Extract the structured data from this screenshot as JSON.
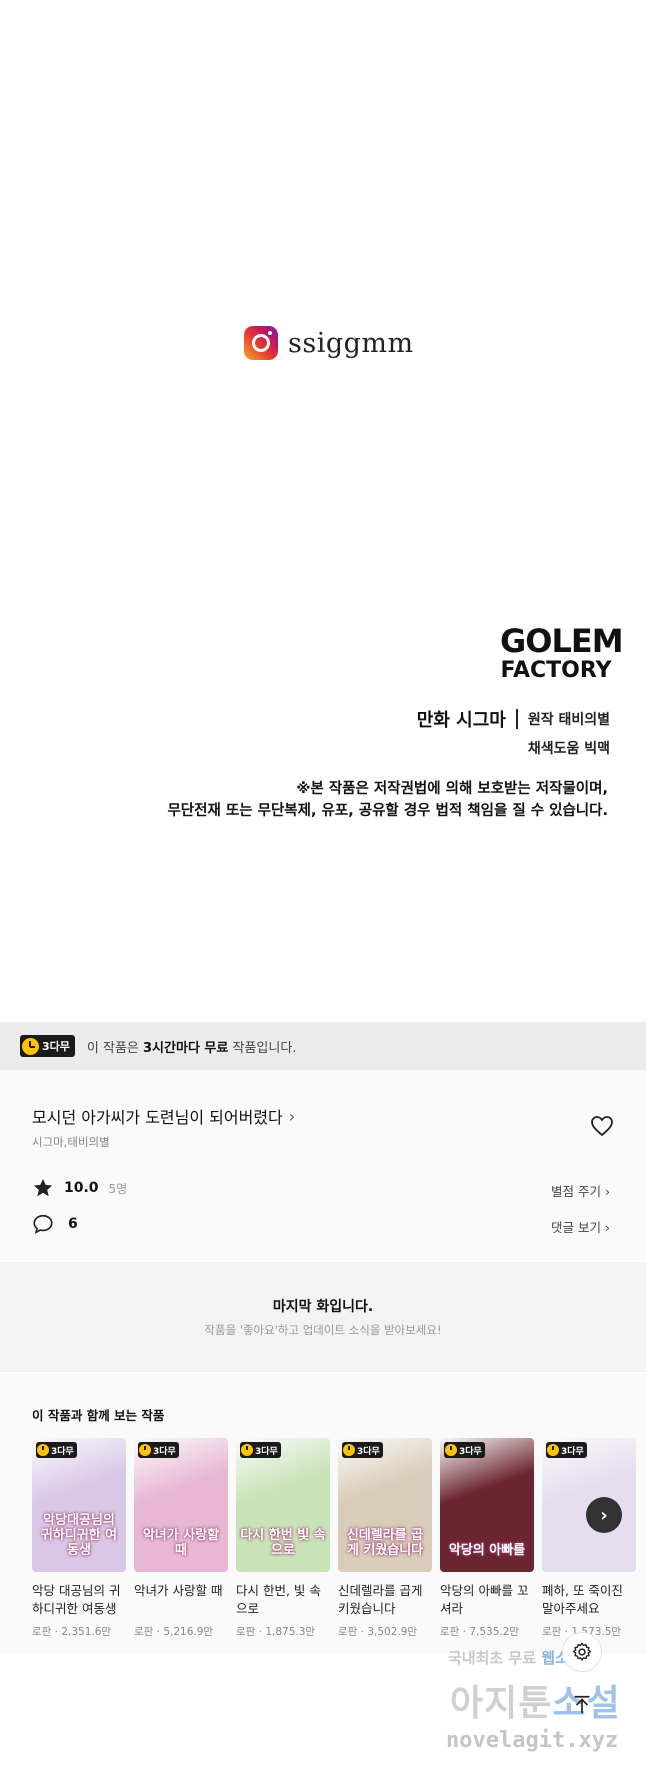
{
  "credits": {
    "instagram_handle": "ssiggmm",
    "studio_line1": "GOLEM",
    "studio_line2": "FACTORY",
    "comic": "만화 시그마",
    "original": "원작 태비의별",
    "coloring": "채색도움 빅맥",
    "copyright_line1": "※본 작품은 저작권법에 의해 보호받는 저작물이며,",
    "copyright_line2": "무단전재 또는 무단복제, 유포, 공유할 경우 법적 책임을 질 수 있습니다."
  },
  "free_banner": {
    "badge": "3다무",
    "text_prefix": "이 작품은 ",
    "text_bold": "3시간마다 무료",
    "text_suffix": " 작품입니다."
  },
  "work": {
    "title": "모시던 아가씨가 도련님이 되어버렸다",
    "authors": "시그마,태비의별",
    "rating": "10.0",
    "rating_count": "5명",
    "rate_link": "별점 주기",
    "comment_count": "6",
    "comment_link": "댓글 보기"
  },
  "last_episode": {
    "title": "마지막 화입니다.",
    "subtitle": "작품을 '좋아요'하고 업데이트 소식을 받아보세요!"
  },
  "recommendations": {
    "title": "이 작품과 함께 보는 작품",
    "badge": "3다무",
    "items": [
      {
        "name": "악당 대공님의 귀하디귀한 여동생",
        "meta": "로판 · 2,351.6만",
        "cover": "악당대공님의 귀하디귀한 여동생",
        "bg": "#d9c7e8"
      },
      {
        "name": "악녀가 사랑할 때",
        "meta": "로판 · 5,216.9만",
        "cover": "악녀가 사랑할 때",
        "bg": "#e8b7d4"
      },
      {
        "name": "다시 한번, 빛 속으로",
        "meta": "로판 · 1,875.3만",
        "cover": "다시 한번 빛 속으로",
        "bg": "#c9e3b8"
      },
      {
        "name": "신데렐라를 곱게 키웠습니다",
        "meta": "로판 · 3,502.9만",
        "cover": "신데렐라를 곱게 키웠습니다",
        "bg": "#d9ccb8"
      },
      {
        "name": "악당의 아빠를 꼬셔라",
        "meta": "로판 · 7,535.2만",
        "cover": "악당의 아빠를",
        "bg": "#6b2530"
      },
      {
        "name": "폐하, 또 죽이진 말아주세요",
        "meta": "로판 · 1,573.5만",
        "cover": "",
        "bg": "#e6ddee"
      }
    ]
  },
  "watermark": {
    "line1a": "국내최초 무료 ",
    "line1b": "웹소설",
    "line2a": "아지툰",
    "line2b": "소설",
    "line3": "novelagit.xyz"
  },
  "colors": {
    "badge_bg": "#1a1a1a",
    "badge_clock": "#ffc400",
    "banner_bg": "#ececec"
  },
  "icons": [
    "instagram-icon",
    "clock-icon",
    "heart-icon",
    "star-icon",
    "comment-icon",
    "chevron-right-icon",
    "gear-icon",
    "arrow-up-icon"
  ]
}
